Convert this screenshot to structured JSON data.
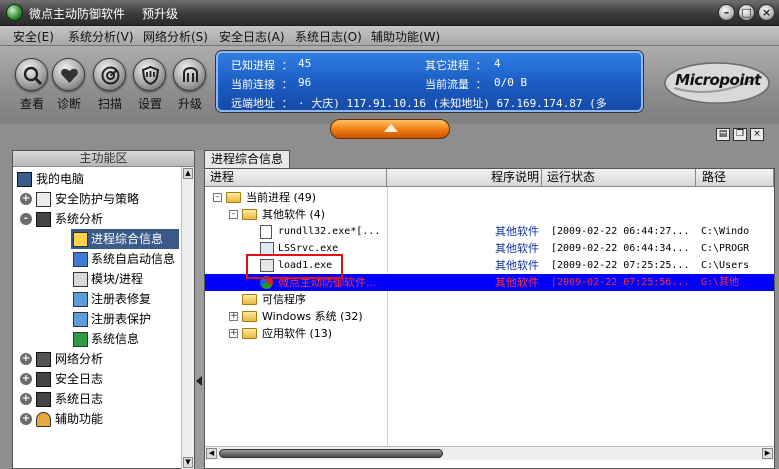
{
  "window": {
    "title": "微点主动防御软件",
    "preview_label": "预升级",
    "controls": [
      "–",
      "□",
      "×"
    ]
  },
  "menu": [
    "安全(E)",
    "系统分析(V)",
    "网络分析(S)",
    "安全日志(A)",
    "系统日志(O)",
    "辅助功能(W)"
  ],
  "toolbar": {
    "buttons": [
      {
        "label": "查看",
        "icon": "magnifier-icon"
      },
      {
        "label": "诊断",
        "icon": "heart-icon"
      },
      {
        "label": "扫描",
        "icon": "radar-icon"
      },
      {
        "label": "设置",
        "icon": "shield-icon"
      },
      {
        "label": "升级",
        "icon": "upgrade-icon"
      }
    ]
  },
  "status": {
    "known_process_label": "已知进程 ：",
    "known_process_value": "45",
    "other_process_label": "其它进程 ：",
    "other_process_value": "4",
    "current_conn_label": "当前连接 ：",
    "current_conn_value": "96",
    "current_traffic_label": "当前流量 ：",
    "current_traffic_value": "0/0 B",
    "remote_label": "远端地址 ：",
    "remote_value": "· 大庆)    117.91.10.16 (未知地址)    67.169.174.87 (多"
  },
  "logo": {
    "text": "Micropoint"
  },
  "left_panel": {
    "header": "主功能区",
    "items": [
      {
        "label": "我的电脑",
        "level": 0
      },
      {
        "label": "安全防护与策略",
        "level": 1,
        "expander": "+"
      },
      {
        "label": "系统分析",
        "level": 1,
        "expander": "-"
      },
      {
        "label": "进程综合信息",
        "level": 2,
        "selected": true
      },
      {
        "label": "系统自启动信息",
        "level": 2
      },
      {
        "label": "模块/进程",
        "level": 2
      },
      {
        "label": "注册表修复",
        "level": 2
      },
      {
        "label": "注册表保护",
        "level": 2
      },
      {
        "label": "系统信息",
        "level": 2
      },
      {
        "label": "网络分析",
        "level": 1,
        "expander": "+"
      },
      {
        "label": "安全日志",
        "level": 1,
        "expander": "+"
      },
      {
        "label": "系统日志",
        "level": 1,
        "expander": "+"
      },
      {
        "label": "辅助功能",
        "level": 1,
        "expander": "+"
      }
    ]
  },
  "right_panel": {
    "tab": "进程综合信息",
    "columns": [
      "进程",
      "程序说明",
      "运行状态",
      "路径"
    ],
    "rows": [
      {
        "name": "当前进程 (49)",
        "level": 0,
        "expander": "-",
        "type": "folder"
      },
      {
        "name": "其他软件 (4)",
        "level": 1,
        "expander": "-",
        "type": "folder"
      },
      {
        "name": "rundll32.exe*[...",
        "level": 2,
        "type": "file",
        "desc": "其他软件",
        "status": "[2009-02-22 06:44:27...",
        "path": "C:\\Windo"
      },
      {
        "name": "LSSrvc.exe",
        "level": 2,
        "type": "file",
        "desc": "其他软件",
        "status": "[2009-02-22 06:44:34...",
        "path": "C:\\PROGR"
      },
      {
        "name": "load1.exe",
        "level": 2,
        "type": "file",
        "desc": "其他软件",
        "status": "[2009-02-22 07:25:25...",
        "path": "C:\\Users"
      },
      {
        "name": "微点主动防御软件...",
        "level": 2,
        "type": "file",
        "desc": "其他软件",
        "status": "[2009-02-22 07:25:56...",
        "path": "G:\\其他",
        "selected": true
      },
      {
        "name": "可信程序",
        "level": 1,
        "type": "folder"
      },
      {
        "name": "Windows 系统 (32)",
        "level": 1,
        "expander": "+",
        "type": "folder"
      },
      {
        "name": "应用软件 (13)",
        "level": 1,
        "expander": "+",
        "type": "folder"
      }
    ]
  },
  "colors": {
    "status_panel": "#1b5bc2",
    "selection": "#0000ff",
    "highlight_box": "#e01010",
    "orange_button": "#f07a10"
  }
}
